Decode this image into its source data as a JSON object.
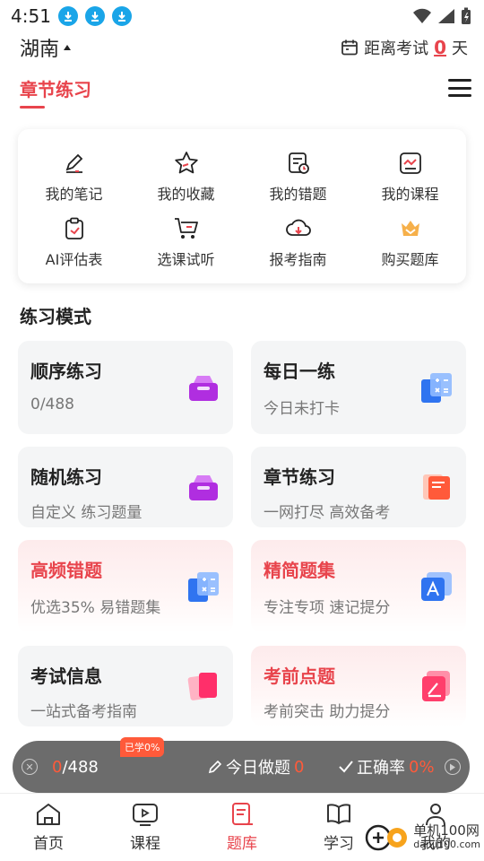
{
  "status": {
    "time": "4:51"
  },
  "header": {
    "region": "湖南",
    "exam_label": "距离考试",
    "exam_days": "0",
    "exam_unit": "天",
    "tab_title": "章节练习"
  },
  "quick": [
    {
      "label": "我的笔记",
      "icon": "note-edit-icon"
    },
    {
      "label": "我的收藏",
      "icon": "star-icon"
    },
    {
      "label": "我的错题",
      "icon": "wrong-questions-icon"
    },
    {
      "label": "我的课程",
      "icon": "course-chart-icon"
    },
    {
      "label": "AI评估表",
      "icon": "clipboard-icon"
    },
    {
      "label": "选课试听",
      "icon": "cart-icon"
    },
    {
      "label": "报考指南",
      "icon": "cloud-download-icon"
    },
    {
      "label": "购买题库",
      "icon": "crown-icon"
    }
  ],
  "section": {
    "title": "练习模式"
  },
  "modes": [
    {
      "title": "顺序练习",
      "sub": "0/488",
      "icon": "purple-box-icon"
    },
    {
      "title": "每日一练",
      "sub": "今日未打卡",
      "icon": "blue-calc-icon"
    },
    {
      "title": "随机练习",
      "sub": "自定义 练习题量",
      "icon": "purple-box-icon"
    },
    {
      "title": "章节练习",
      "sub": "一网打尽 高效备考",
      "icon": "orange-book-icon"
    },
    {
      "title": "高频错题",
      "sub": "优选35% 易错题集",
      "icon": "blue-calc-icon"
    },
    {
      "title": "精简题集",
      "sub": "专注专项 速记提分",
      "icon": "blue-ai-icon"
    },
    {
      "title": "考试信息",
      "sub": "一站式备考指南",
      "icon": "pink-cards-icon"
    },
    {
      "title": "考前点题",
      "sub": "考前突击 助力提分",
      "icon": "pink-pen-icon"
    }
  ],
  "floatbar": {
    "done": "0",
    "total": "/488",
    "badge": "已学0%",
    "today_label": "今日做题",
    "today_value": "0",
    "accuracy_label": "正确率",
    "accuracy_value": "0%"
  },
  "nav": [
    {
      "label": "首页",
      "icon": "home-icon"
    },
    {
      "label": "课程",
      "icon": "video-icon"
    },
    {
      "label": "题库",
      "icon": "question-bank-icon"
    },
    {
      "label": "学习",
      "icon": "book-icon"
    },
    {
      "label": "我的",
      "icon": "person-icon"
    }
  ],
  "watermark": {
    "line1": "单机100网",
    "line2": "danji100.com"
  },
  "colors": {
    "accent": "#e8444c",
    "float_bg": "#6c6c6c",
    "download": "#1aa5e8"
  }
}
